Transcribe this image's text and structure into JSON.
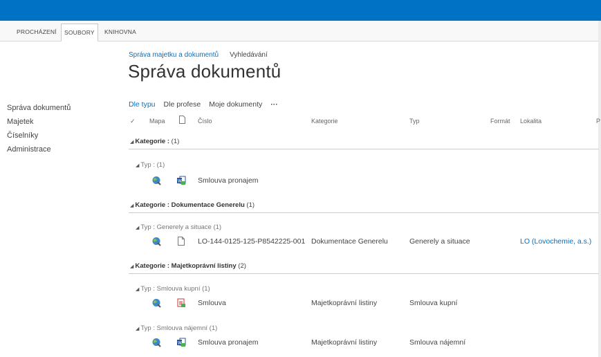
{
  "ribbon": {
    "tabs": [
      {
        "label": "PROCHÁZENÍ",
        "active": false
      },
      {
        "label": "SOUBORY",
        "active": true
      },
      {
        "label": "KNIHOVNA",
        "active": false
      }
    ]
  },
  "nav": {
    "items": [
      "Správa dokumentů",
      "Majetek",
      "Číselníky",
      "Administrace"
    ]
  },
  "breadcrumb": {
    "items": [
      "Správa majetku a dokumentů",
      "Vyhledávání"
    ]
  },
  "page_title": "Správa dokumentů",
  "views": {
    "items": [
      "Dle typu",
      "Dle profese",
      "Moje dokumenty"
    ],
    "selected": "Dle typu",
    "more": "···"
  },
  "columns": {
    "check": "✓",
    "mapa": "Mapa",
    "cislo": "Číslo",
    "kategorie": "Kategorie",
    "typ": "Typ",
    "format": "Formát",
    "lokalita": "Lokalita",
    "extra": "P"
  },
  "groups": [
    {
      "label": "Kategorie :",
      "value": "",
      "count": "(1)",
      "subgroups": [
        {
          "label": "Typ :",
          "value": "",
          "count": "(1)",
          "rows": [
            {
              "icon": "word-document-icon",
              "cislo": "Smlouva pronajem",
              "kategorie": "",
              "typ": "",
              "lokalita": ""
            }
          ]
        }
      ]
    },
    {
      "label": "Kategorie :",
      "value": "Dokumentace Generelu",
      "count": "(1)",
      "subgroups": [
        {
          "label": "Typ :",
          "value": "Generely a situace",
          "count": "(1)",
          "rows": [
            {
              "icon": "blank-document-icon",
              "cislo": "LO-144-0125-125-P8542225-001",
              "kategorie": "Dokumentace Generelu",
              "typ": "Generely a situace",
              "lokalita": "LO (Lovochemie, a.s.)"
            }
          ]
        }
      ]
    },
    {
      "label": "Kategorie :",
      "value": "Majetkoprávní listiny",
      "count": "(2)",
      "subgroups": [
        {
          "label": "Typ :",
          "value": "Smlouva kupní",
          "count": "(1)",
          "rows": [
            {
              "icon": "pdf-document-icon",
              "cislo": "Smlouva",
              "kategorie": "Majetkoprávní listiny",
              "typ": "Smlouva kupní",
              "lokalita": ""
            }
          ]
        },
        {
          "label": "Typ :",
          "value": "Smlouva nájemní",
          "count": "(1)",
          "rows": [
            {
              "icon": "word-document-icon",
              "cislo": "Smlouva pronajem",
              "kategorie": "Majetkoprávní listiny",
              "typ": "Smlouva nájemní",
              "lokalita": ""
            }
          ]
        }
      ]
    }
  ]
}
